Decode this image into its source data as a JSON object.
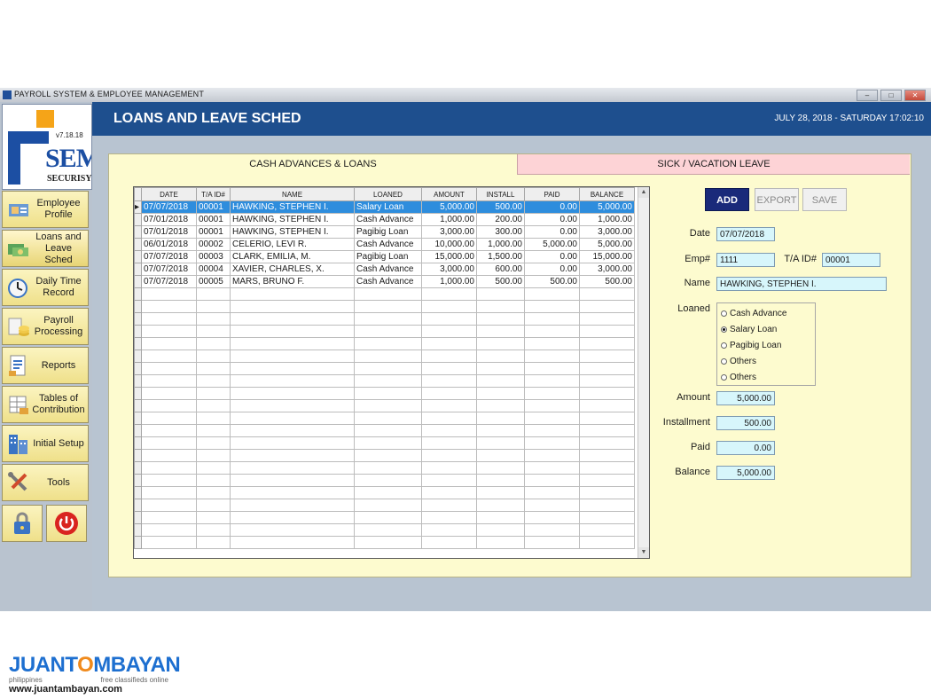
{
  "window": {
    "title": "PAYROLL SYSTEM & EMPLOYEE MANAGEMENT",
    "controls": [
      "minimize",
      "maximize",
      "close"
    ]
  },
  "logo": {
    "version": "v7.18.18",
    "brand": "SEM",
    "company": "SECURISYS"
  },
  "sidebar": {
    "items": [
      {
        "label": "Employee Profile",
        "icon": "employee-icon"
      },
      {
        "label": "Loans and Leave Sched",
        "icon": "loans-icon"
      },
      {
        "label": "Daily Time Record",
        "icon": "clock-icon"
      },
      {
        "label": "Payroll Processing",
        "icon": "money-icon"
      },
      {
        "label": "Reports",
        "icon": "reports-icon"
      },
      {
        "label": "Tables of Contribution",
        "icon": "table-icon"
      },
      {
        "label": "Initial Setup",
        "icon": "building-icon"
      },
      {
        "label": "Tools",
        "icon": "tools-icon"
      }
    ],
    "lock_icon": "lock-icon",
    "power_icon": "power-icon"
  },
  "header": {
    "title": "LOANS AND LEAVE SCHED",
    "datetime": "JULY 28, 2018 - SATURDAY 17:02:10"
  },
  "tabs": {
    "cash": "CASH ADVANCES & LOANS",
    "sick": "SICK / VACATION LEAVE"
  },
  "grid": {
    "columns": [
      "DATE",
      "T/A ID#",
      "NAME",
      "LOANED",
      "AMOUNT",
      "INSTALL",
      "PAID",
      "BALANCE"
    ],
    "rows": [
      [
        "07/07/2018",
        "00001",
        "HAWKING, STEPHEN I.",
        "Salary Loan",
        "5,000.00",
        "500.00",
        "0.00",
        "5,000.00"
      ],
      [
        "07/01/2018",
        "00001",
        "HAWKING, STEPHEN I.",
        "Cash Advance",
        "1,000.00",
        "200.00",
        "0.00",
        "1,000.00"
      ],
      [
        "07/01/2018",
        "00001",
        "HAWKING, STEPHEN I.",
        "Pagibig Loan",
        "3,000.00",
        "300.00",
        "0.00",
        "3,000.00"
      ],
      [
        "06/01/2018",
        "00002",
        "CELERIO, LEVI R.",
        "Cash Advance",
        "10,000.00",
        "1,000.00",
        "5,000.00",
        "5,000.00"
      ],
      [
        "07/07/2018",
        "00003",
        "CLARK, EMILIA, M.",
        "Pagibig Loan",
        "15,000.00",
        "1,500.00",
        "0.00",
        "15,000.00"
      ],
      [
        "07/07/2018",
        "00004",
        "XAVIER, CHARLES, X.",
        "Cash Advance",
        "3,000.00",
        "600.00",
        "0.00",
        "3,000.00"
      ],
      [
        "07/07/2018",
        "00005",
        "MARS, BRUNO F.",
        "Cash Advance",
        "1,000.00",
        "500.00",
        "500.00",
        "500.00"
      ]
    ],
    "selected_row": 0
  },
  "form": {
    "buttons": {
      "add": "ADD",
      "export": "EXPORT",
      "save": "SAVE"
    },
    "date_label": "Date",
    "date_value": "07/07/2018",
    "emp_label": "Emp#",
    "emp_value": "1111",
    "ta_label": "T/A ID#",
    "ta_value": "00001",
    "name_label": "Name",
    "name_value": "HAWKING, STEPHEN I.",
    "loaned_label": "Loaned",
    "loaned_options": [
      "Cash Advance",
      "Salary Loan",
      "Pagibig Loan",
      "Others",
      "Others"
    ],
    "loaned_selected": 1,
    "amount_label": "Amount",
    "amount_value": "5,000.00",
    "installment_label": "Installment",
    "installment_value": "500.00",
    "paid_label": "Paid",
    "paid_value": "0.00",
    "balance_label": "Balance",
    "balance_value": "5,000.00"
  },
  "watermark": {
    "brand_left": "JUANT",
    "brand_o": "O",
    "brand_right": "MBAYAN",
    "tag_left": "philippines",
    "tag_right": "free classifieds online",
    "url": "www.juantambayan.com"
  }
}
